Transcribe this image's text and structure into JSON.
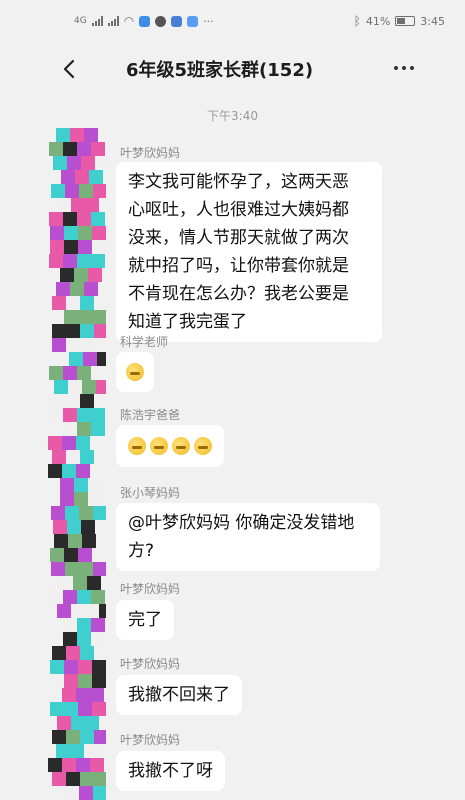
{
  "status_bar": {
    "network": "4G",
    "battery_percent": "41%",
    "time": "3:45"
  },
  "header": {
    "title": "6年级5班家长群(152)"
  },
  "timestamp": "下午3:40",
  "messages": [
    {
      "sender": "叶梦欣妈妈",
      "lines": [
        "李文我可能怀孕了，这两天恶",
        "心呕吐，人也很难过大姨妈都",
        "没来，情人节那天就做了两次",
        "就中招了吗，让你带套你就是",
        "不肯现在怎么办？我老公要是",
        "知道了我完蛋了"
      ]
    },
    {
      "sender": "科学老师",
      "emoji_count": 1
    },
    {
      "sender": "陈浩宇爸爸",
      "emoji_count": 4
    },
    {
      "sender": "张小琴妈妈",
      "lines": [
        "@叶梦欣妈妈 你确定没发错地",
        "方?"
      ]
    },
    {
      "sender": "叶梦欣妈妈",
      "text": "完了"
    },
    {
      "sender": "叶梦欣妈妈",
      "text": "我撤不回来了"
    },
    {
      "sender": "叶梦欣妈妈",
      "text": "我撤不了呀"
    }
  ],
  "colors": {
    "background": "#f1f1f1",
    "bubble": "#ffffff",
    "mosaic": [
      "#3fcfcf",
      "#e85aa8",
      "#b84fd0",
      "#2a2a2a",
      "#f0f0f0",
      "#7ab07a"
    ]
  }
}
